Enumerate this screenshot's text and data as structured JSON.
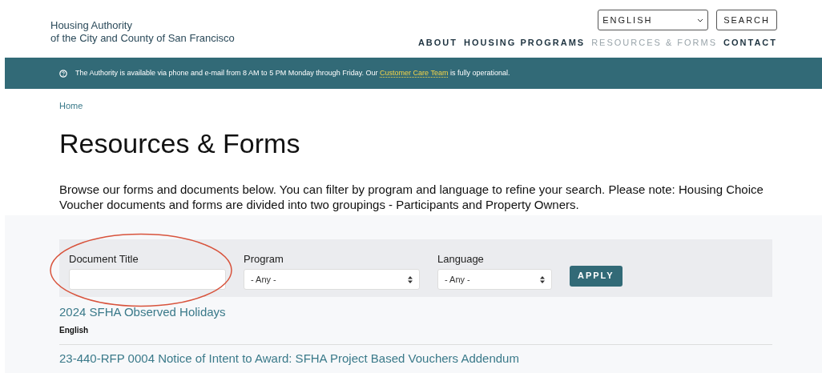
{
  "logo": {
    "line_1": "Housing Authority",
    "line_2": "of the City and County of San Francisco"
  },
  "language_select": {
    "value": "ENGLISH"
  },
  "search_button": "SEARCH",
  "nav": [
    {
      "label": "ABOUT",
      "selected": false
    },
    {
      "label": "HOUSING PROGRAMS",
      "selected": false
    },
    {
      "label": "RESOURCES & FORMS",
      "selected": true
    },
    {
      "label": "CONTACT",
      "selected": false
    }
  ],
  "notice": {
    "before": "The Authority is available via phone and e-mail from 8 AM to 5 PM Monday through Friday. Our",
    "link": "Customer Care Team",
    "after": "is fully operational."
  },
  "breadcrumb": [
    "Home"
  ],
  "title": "Resources & Forms",
  "intro": "Browse our forms and documents below. You can filter by program and language to refine your search. Please note: Housing Choice Voucher documents and forms are divided into two groupings - Participants and Property Owners.",
  "filters": [
    {
      "kind": "text",
      "label": "Document Title"
    },
    {
      "kind": "select",
      "label": "Program",
      "value": "- Any -"
    },
    {
      "kind": "select",
      "label": "Language",
      "value": "- Any -"
    }
  ],
  "apply_button": "APPLY",
  "documents": [
    {
      "title": "2024 SFHA Observed Holidays",
      "language": "English"
    },
    {
      "title": "23-440-RFP 0004 Notice of Intent to Award: SFHA Project Based Vouchers Addendum"
    }
  ]
}
